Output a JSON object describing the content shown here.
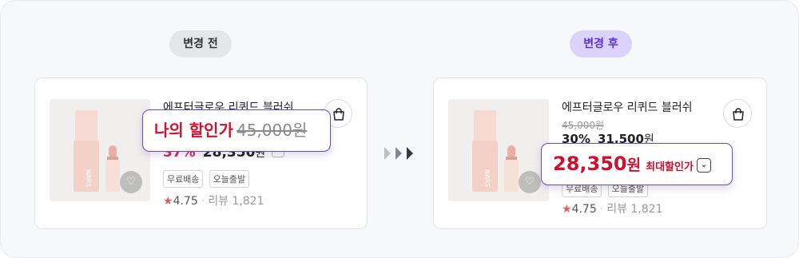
{
  "labels": {
    "before": "변경 전",
    "after": "변경 후"
  },
  "product": {
    "title_before": "에프터글로우 리퀴드 블러쉬",
    "title": "에프터글로우 리퀴드 블러쉬",
    "original_price": "45,000원",
    "discount_rate": "30%",
    "sale_price": "31,500",
    "sale_won": "원",
    "badges": [
      "무료배송",
      "오늘출발"
    ],
    "star": "★",
    "rating": "4.75",
    "review_label": "리뷰",
    "review_count": "1,821",
    "brand_text": "NARS"
  },
  "before": {
    "discount_rate": "37%",
    "price": "28,350",
    "won": "원",
    "callout_label": "나의 할인가",
    "callout_strike": "45,000원"
  },
  "after": {
    "price": "28,350",
    "won": "원",
    "callout_label": "최대할인가",
    "chevron": "⌄"
  },
  "icons": {
    "cart": "shopping-bag-icon",
    "wishlist": "heart-icon",
    "arrows": "triple-chevron-right-icon"
  },
  "colors": {
    "accent_purple": "#6a48d8",
    "price_red": "#d0102d",
    "discount_pink": "#e0254f",
    "pill_after_bg": "#dcd3fb"
  }
}
